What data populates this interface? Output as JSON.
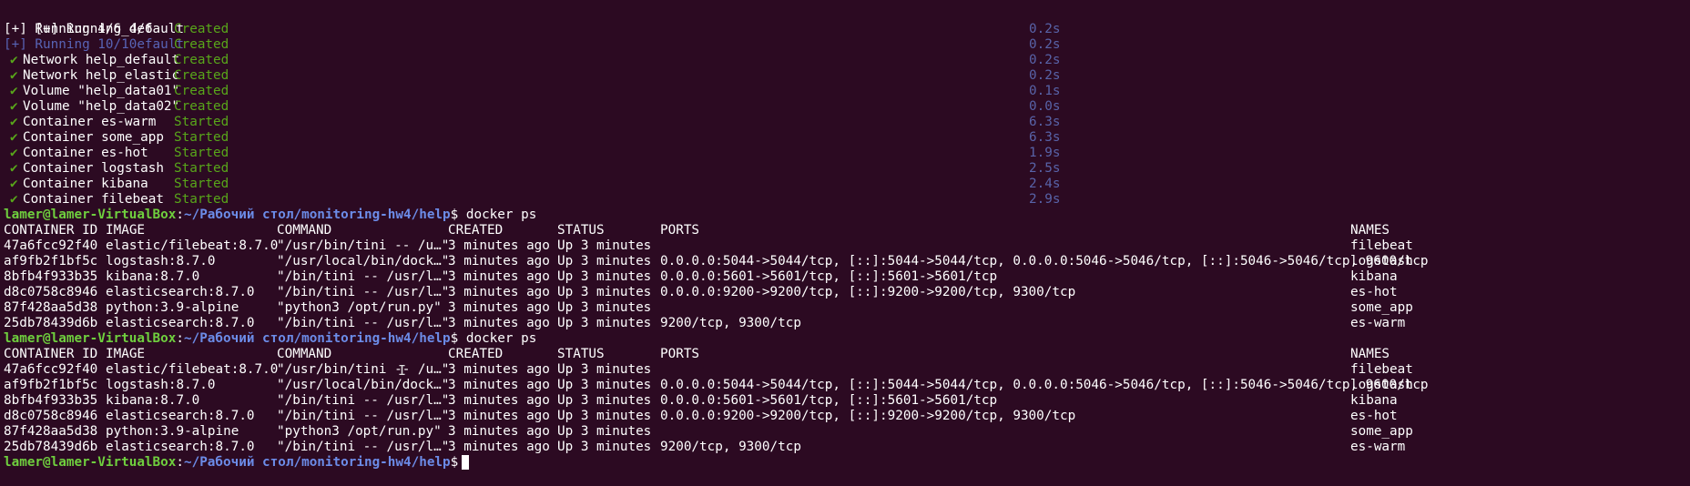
{
  "compose": {
    "header1": "[+] Running 4/6",
    "header2": "[+] Running 4/6_default",
    "header2_status": "Created",
    "header2_time": "0.2s",
    "header3": "[+] Running 10/10efault",
    "header3_status": "Created",
    "header3_time": "0.2s",
    "check_glyph": "✔",
    "items": [
      {
        "name": "Network help_default",
        "status": "Created",
        "time": "0.2s"
      },
      {
        "name": "Network help_elastic",
        "status": "Created",
        "time": "0.2s"
      },
      {
        "name": "Volume \"help_data01\"",
        "status": "Created",
        "time": "0.1s"
      },
      {
        "name": "Volume \"help_data02\"",
        "status": "Created",
        "time": "0.0s"
      },
      {
        "name": "Container es-warm",
        "status": "Started",
        "time": "6.3s"
      },
      {
        "name": "Container some_app",
        "status": "Started",
        "time": "6.3s"
      },
      {
        "name": "Container es-hot",
        "status": "Started",
        "time": "1.9s"
      },
      {
        "name": "Container logstash",
        "status": "Started",
        "time": "2.5s"
      },
      {
        "name": "Container kibana",
        "status": "Started",
        "time": "2.4s"
      },
      {
        "name": "Container filebeat",
        "status": "Started",
        "time": "2.9s"
      }
    ]
  },
  "prompt": {
    "user_host": "lamer@lamer-VirtualBox",
    "path": "~/Рабочий стол/monitoring-hw4/help",
    "symbol": "$",
    "command": "docker ps"
  },
  "ps": {
    "headers": [
      "CONTAINER ID",
      "IMAGE",
      "COMMAND",
      "CREATED",
      "STATUS",
      "PORTS",
      "NAMES"
    ],
    "rows": [
      [
        "47a6fcc92f40",
        "elastic/filebeat:8.7.0",
        "\"/usr/bin/tini -- /u…\"",
        "3 minutes ago",
        "Up 3 minutes",
        "",
        "filebeat"
      ],
      [
        "af9fb2f1bf5c",
        "logstash:8.7.0",
        "\"/usr/local/bin/dock…\"",
        "3 minutes ago",
        "Up 3 minutes",
        "0.0.0.0:5044->5044/tcp, [::]:5044->5044/tcp, 0.0.0.0:5046->5046/tcp, [::]:5046->5046/tcp, 9600/tcp",
        "logstash"
      ],
      [
        "8bfb4f933b35",
        "kibana:8.7.0",
        "\"/bin/tini -- /usr/l…\"",
        "3 minutes ago",
        "Up 3 minutes",
        "0.0.0.0:5601->5601/tcp, [::]:5601->5601/tcp",
        "kibana"
      ],
      [
        "d8c0758c8946",
        "elasticsearch:8.7.0",
        "\"/bin/tini -- /usr/l…\"",
        "3 minutes ago",
        "Up 3 minutes",
        "0.0.0.0:9200->9200/tcp, [::]:9200->9200/tcp, 9300/tcp",
        "es-hot"
      ],
      [
        "87f428aa5d38",
        "python:3.9-alpine",
        "\"python3 /opt/run.py\"",
        "3 minutes ago",
        "Up 3 minutes",
        "",
        "some_app"
      ],
      [
        "25db78439d6b",
        "elasticsearch:8.7.0",
        "\"/bin/tini -- /usr/l…\"",
        "3 minutes ago",
        "Up 3 minutes",
        "9200/tcp, 9300/tcp",
        "es-warm"
      ]
    ]
  },
  "colors": {
    "background": "#2c0a22",
    "prompt_user": "#6fcf3e",
    "prompt_path": "#6c8ce8",
    "status_green": "#58a61a",
    "duration_blue": "#5863a8"
  }
}
